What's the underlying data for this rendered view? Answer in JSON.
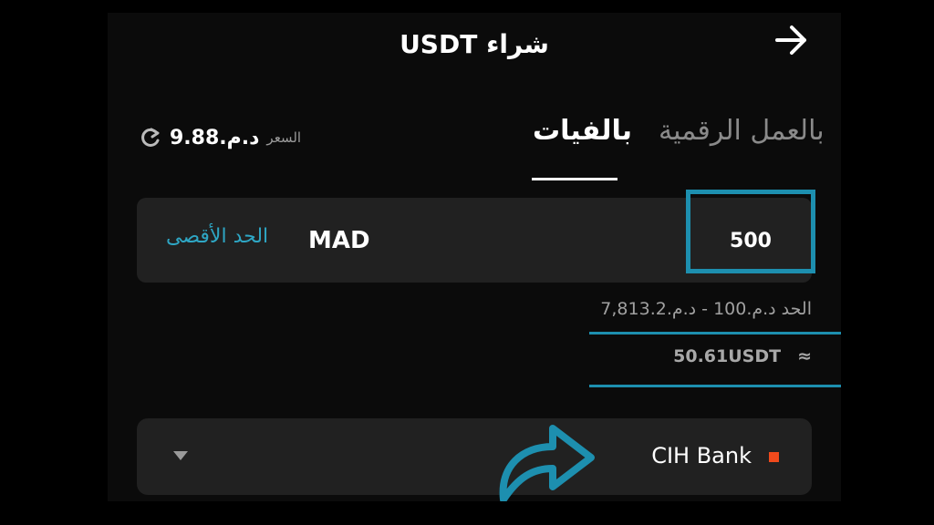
{
  "header": {
    "title": "USDT شراء"
  },
  "rate": {
    "label": "السعر",
    "value": "د.م.9.88"
  },
  "tabs": [
    {
      "label": "بالفيات",
      "active": true
    },
    {
      "label": "بالعمل الرقمية",
      "active": false
    }
  ],
  "amount": {
    "value": "500",
    "currency": "MAD",
    "max_label": "الحد الأقصى"
  },
  "limits": {
    "text": "الحد د.م.100 - د.م.7,813.2"
  },
  "estimate": {
    "approx_symbol": "≈",
    "value": "50.61USDT"
  },
  "payment": {
    "bank_name": "CIH Bank"
  },
  "colors": {
    "accent": "#1d8faf",
    "bank_dot": "#f04a1c",
    "panel": "#212121",
    "background": "#0b0b0b"
  }
}
